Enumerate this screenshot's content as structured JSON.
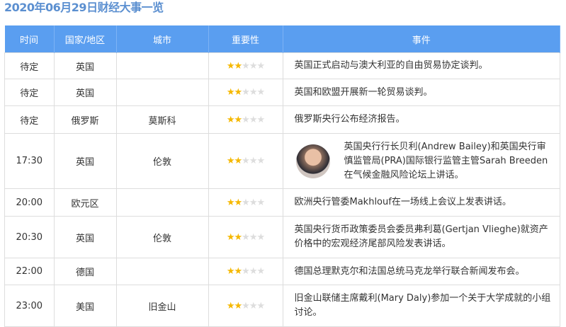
{
  "title": "2020年06月29日财经大事一览",
  "headers": [
    "时间",
    "国家/地区",
    "城市",
    "重要性",
    "事件"
  ],
  "colors": {
    "header_bg": "#5a9ef0",
    "star_on": "#f5b800"
  },
  "rows": [
    {
      "time": "待定",
      "country": "英国",
      "city": "",
      "stars": 2,
      "event": "英国正式启动与澳大利亚的自由贸易协定谈判。"
    },
    {
      "time": "待定",
      "country": "英国",
      "city": "",
      "stars": 2,
      "event": "英国和欧盟开展新一轮贸易谈判。"
    },
    {
      "time": "待定",
      "country": "俄罗斯",
      "city": "莫斯科",
      "stars": 2,
      "event": "俄罗斯央行公布经济报告。"
    },
    {
      "time": "17:30",
      "country": "英国",
      "city": "伦敦",
      "stars": 2,
      "event": "英国央行行长贝利(Andrew Bailey)和英国央行审慎监管局(PRA)国际银行监管主管Sarah Breeden在气候金融风险论坛上讲话。"
    },
    {
      "time": "20:00",
      "country": "欧元区",
      "city": "",
      "stars": 2,
      "event": "欧洲央行管委Makhlouf在一场线上会议上发表讲话。"
    },
    {
      "time": "20:30",
      "country": "英国",
      "city": "伦敦",
      "stars": 2,
      "event": "英国央行货币政策委员会委员弗利葛(Gertjan Vlieghe)就资产价格中的宏观经济尾部风险发表讲话。"
    },
    {
      "time": "22:00",
      "country": "德国",
      "city": "",
      "stars": 2,
      "event": "德国总理默克尔和法国总统马克龙举行联合新闻发布会。"
    },
    {
      "time": "23:00",
      "country": "美国",
      "city": "旧金山",
      "stars": 2,
      "event": "旧金山联储主席戴利(Mary Daly)参加一个关于大学成就的小组讨论。"
    }
  ]
}
